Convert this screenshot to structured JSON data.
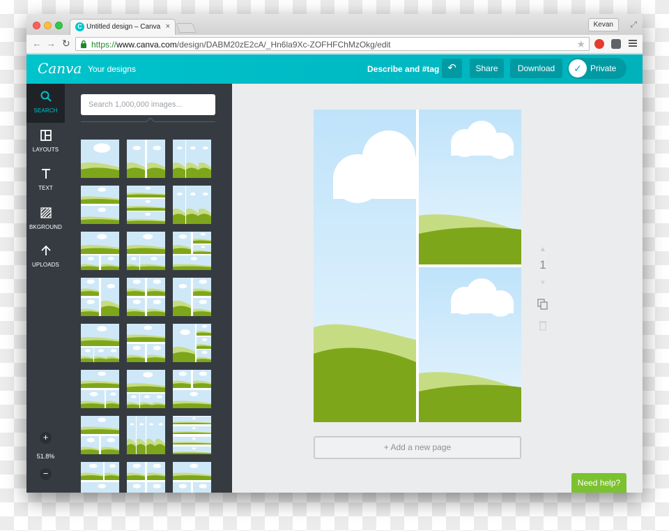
{
  "browser": {
    "tab_title": "Untitled design – Canva",
    "tab_favicon": "C",
    "tab_close": "×",
    "user_name": "Kevan",
    "url_scheme": "https://",
    "url_host": "www.canva.com",
    "url_path": "/design/DABM20zE2cA/_Hn6la9Xc-ZOFHFChMzOkg/edit"
  },
  "header": {
    "logo": "Canva",
    "your_designs": "Your designs",
    "describe": "Describe and #tag",
    "undo_icon": "undo-icon",
    "share_label": "Share",
    "download_label": "Download",
    "private_label": "Private",
    "accent": "#00c4cc"
  },
  "rail": {
    "items": [
      {
        "label": "SEARCH",
        "icon": "search-icon",
        "active": true
      },
      {
        "label": "LAYOUTS",
        "icon": "layouts-icon",
        "active": false
      },
      {
        "label": "TEXT",
        "icon": "text-icon",
        "active": false
      },
      {
        "label": "BKGROUND",
        "icon": "background-icon",
        "active": false
      },
      {
        "label": "UPLOADS",
        "icon": "upload-icon",
        "active": false
      }
    ],
    "zoom_in": "+",
    "zoom_level": "51.8%",
    "zoom_out": "−"
  },
  "panel": {
    "search_placeholder": "Search 1,000,000 images..."
  },
  "canvas": {
    "page_number": "1",
    "add_page_label": "+ Add a new page",
    "help_label": "Need help?",
    "help_color": "#7cc130"
  }
}
